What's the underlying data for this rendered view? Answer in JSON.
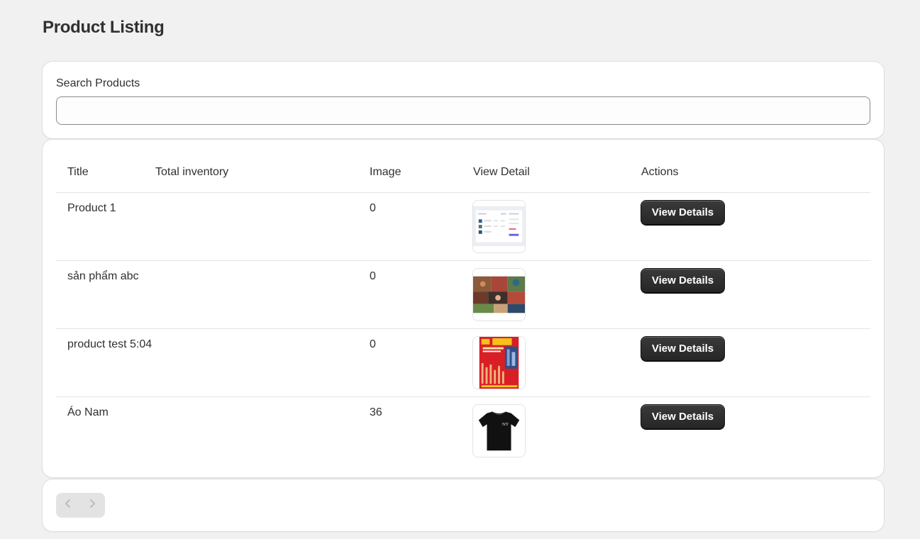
{
  "page": {
    "title": "Product Listing"
  },
  "search": {
    "label": "Search Products",
    "value": "",
    "placeholder": ""
  },
  "table": {
    "headers": [
      "Title",
      "Total inventory",
      "Image",
      "View Detail",
      "Actions"
    ],
    "rows": [
      {
        "title": "Product 1",
        "inventory": "0",
        "thumbnail": "dashboard-screenshot",
        "action_label": "View Details"
      },
      {
        "title": "sản phẩm abc",
        "inventory": "0",
        "thumbnail": "photo-collage",
        "action_label": "View Details"
      },
      {
        "title": "product test 5:04",
        "inventory": "0",
        "thumbnail": "red-promo-poster",
        "action_label": "View Details"
      },
      {
        "title": "Áo Nam",
        "inventory": "36",
        "thumbnail": "black-tshirt",
        "action_label": "View Details"
      }
    ]
  },
  "pagination": {
    "prev_icon": "chevron-left-icon",
    "next_icon": "chevron-right-icon",
    "prev_enabled": false,
    "next_enabled": false
  }
}
